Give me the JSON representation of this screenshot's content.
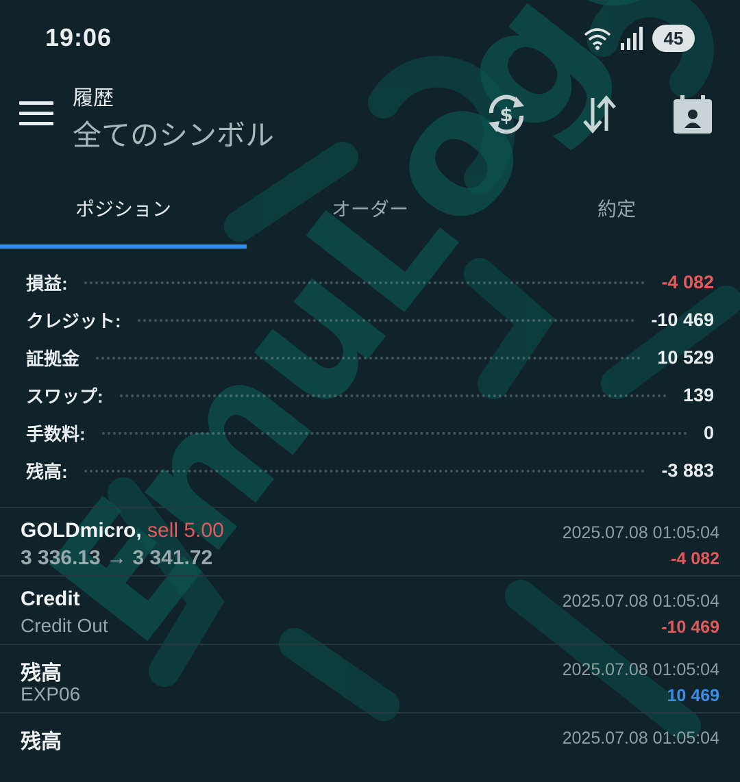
{
  "status_bar": {
    "time": "19:06",
    "battery": "45"
  },
  "header": {
    "title": "履歴",
    "subtitle": "全てのシンボル"
  },
  "tabs": [
    {
      "label": "ポジション",
      "active": true
    },
    {
      "label": "オーダー",
      "active": false
    },
    {
      "label": "約定",
      "active": false
    }
  ],
  "summary": [
    {
      "label": "損益:",
      "value": "-4 082",
      "negative": true
    },
    {
      "label": "クレジット:",
      "value": "-10 469",
      "negative": false
    },
    {
      "label": "証拠金",
      "value": "10 529",
      "negative": false
    },
    {
      "label": "スワップ:",
      "value": "139",
      "negative": false
    },
    {
      "label": "手数料:",
      "value": "0",
      "negative": false
    },
    {
      "label": "残高:",
      "value": "-3 883",
      "negative": false
    }
  ],
  "history": [
    {
      "symbol": "GOLDmicro,",
      "side": "sell 5.00",
      "detail": "3 336.13 → 3 341.72",
      "datetime": "2025.07.08 01:05:04",
      "amount": "-4 082"
    },
    {
      "symbol": "Credit",
      "detail": "Credit Out",
      "datetime": "2025.07.08 01:05:04",
      "amount": "-10 469"
    },
    {
      "symbol": "残高",
      "detail": "EXP06",
      "datetime": "2025.07.08 01:05:04",
      "amount": "10 469"
    },
    {
      "symbol": "残高",
      "datetime": "2025.07.08 01:05:04"
    }
  ],
  "watermark": "EmuLog© ガジェット & ワーク 生活",
  "colors": {
    "background": "#10232b",
    "negative": "#e45a5a",
    "positive": "#3b8ee8",
    "accent": "#2f8ff0",
    "watermark": "#0d5a55"
  }
}
